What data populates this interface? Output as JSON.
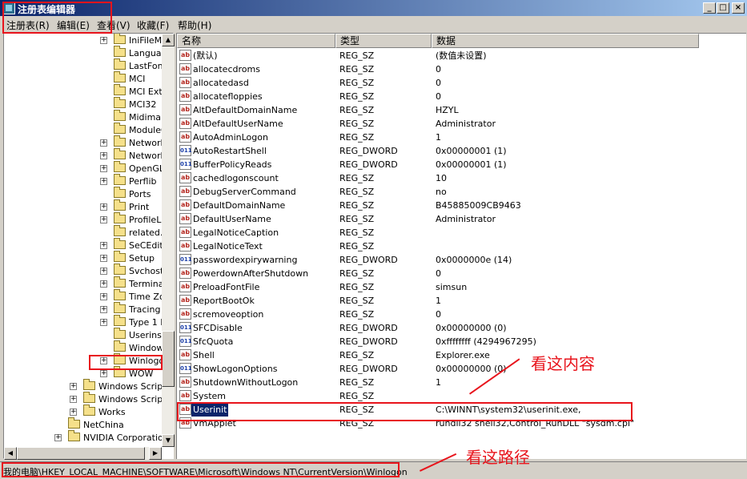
{
  "window": {
    "title": "注册表编辑器",
    "buttons": [
      "_",
      "□",
      "×"
    ]
  },
  "menu": [
    "注册表(R)",
    "编辑(E)",
    "查看(V)",
    "收藏(F)",
    "帮助(H)"
  ],
  "tree": {
    "items": [
      {
        "label": "IniFileMa",
        "expand": "+"
      },
      {
        "label": "Languag",
        "expand": ""
      },
      {
        "label": "LastFon",
        "expand": ""
      },
      {
        "label": "MCI",
        "expand": ""
      },
      {
        "label": "MCI Ext",
        "expand": ""
      },
      {
        "label": "MCI32",
        "expand": ""
      },
      {
        "label": "Midimap",
        "expand": ""
      },
      {
        "label": "ModuleC",
        "expand": ""
      },
      {
        "label": "Network",
        "expand": "+"
      },
      {
        "label": "Network",
        "expand": "+"
      },
      {
        "label": "OpenGL",
        "expand": "+"
      },
      {
        "label": "Perflib",
        "expand": "+"
      },
      {
        "label": "Ports",
        "expand": ""
      },
      {
        "label": "Print",
        "expand": "+"
      },
      {
        "label": "ProfileLi",
        "expand": "+"
      },
      {
        "label": "related.",
        "expand": ""
      },
      {
        "label": "SeCEdit",
        "expand": "+"
      },
      {
        "label": "Setup",
        "expand": "+"
      },
      {
        "label": "Svchost",
        "expand": "+"
      },
      {
        "label": "Termina",
        "expand": "+"
      },
      {
        "label": "Time Zo",
        "expand": "+"
      },
      {
        "label": "Tracing",
        "expand": "+"
      },
      {
        "label": "Type 1 I",
        "expand": "+"
      },
      {
        "label": "Userinst",
        "expand": ""
      },
      {
        "label": "Window",
        "expand": ""
      },
      {
        "label": "Winlogo",
        "expand": "+"
      },
      {
        "label": "WOW",
        "expand": "+"
      },
      {
        "label": "Windows Script",
        "expand": "+"
      },
      {
        "label": "Windows Scripti",
        "expand": "+"
      },
      {
        "label": "Works",
        "expand": "+"
      },
      {
        "label": "NetChina",
        "expand": ""
      },
      {
        "label": "NVIDIA Corporation",
        "expand": "+"
      }
    ]
  },
  "list": {
    "columns": [
      "名称",
      "类型",
      "数据"
    ],
    "rows": [
      {
        "name": "(默认)",
        "type": "REG_SZ",
        "data": "(数值未设置)",
        "icon": "ab"
      },
      {
        "name": "allocatecdroms",
        "type": "REG_SZ",
        "data": "0",
        "icon": "ab"
      },
      {
        "name": "allocatedasd",
        "type": "REG_SZ",
        "data": "0",
        "icon": "ab"
      },
      {
        "name": "allocatefloppies",
        "type": "REG_SZ",
        "data": "0",
        "icon": "ab"
      },
      {
        "name": "AltDefaultDomainName",
        "type": "REG_SZ",
        "data": "HZYL",
        "icon": "ab"
      },
      {
        "name": "AltDefaultUserName",
        "type": "REG_SZ",
        "data": "Administrator",
        "icon": "ab"
      },
      {
        "name": "AutoAdminLogon",
        "type": "REG_SZ",
        "data": "1",
        "icon": "ab"
      },
      {
        "name": "AutoRestartShell",
        "type": "REG_DWORD",
        "data": "0x00000001 (1)",
        "icon": "011"
      },
      {
        "name": "BufferPolicyReads",
        "type": "REG_DWORD",
        "data": "0x00000001 (1)",
        "icon": "011"
      },
      {
        "name": "cachedlogonscount",
        "type": "REG_SZ",
        "data": "10",
        "icon": "ab"
      },
      {
        "name": "DebugServerCommand",
        "type": "REG_SZ",
        "data": "no",
        "icon": "ab"
      },
      {
        "name": "DefaultDomainName",
        "type": "REG_SZ",
        "data": "B45885009CB9463",
        "icon": "ab"
      },
      {
        "name": "DefaultUserName",
        "type": "REG_SZ",
        "data": "Administrator",
        "icon": "ab"
      },
      {
        "name": "LegalNoticeCaption",
        "type": "REG_SZ",
        "data": "",
        "icon": "ab"
      },
      {
        "name": "LegalNoticeText",
        "type": "REG_SZ",
        "data": "",
        "icon": "ab"
      },
      {
        "name": "passwordexpirywarning",
        "type": "REG_DWORD",
        "data": "0x0000000e (14)",
        "icon": "011"
      },
      {
        "name": "PowerdownAfterShutdown",
        "type": "REG_SZ",
        "data": "0",
        "icon": "ab"
      },
      {
        "name": "PreloadFontFile",
        "type": "REG_SZ",
        "data": "simsun",
        "icon": "ab"
      },
      {
        "name": "ReportBootOk",
        "type": "REG_SZ",
        "data": "1",
        "icon": "ab"
      },
      {
        "name": "scremoveoption",
        "type": "REG_SZ",
        "data": "0",
        "icon": "ab"
      },
      {
        "name": "SFCDisable",
        "type": "REG_DWORD",
        "data": "0x00000000 (0)",
        "icon": "011"
      },
      {
        "name": "SfcQuota",
        "type": "REG_DWORD",
        "data": "0xffffffff (4294967295)",
        "icon": "011"
      },
      {
        "name": "Shell",
        "type": "REG_SZ",
        "data": "Explorer.exe",
        "icon": "ab"
      },
      {
        "name": "ShowLogonOptions",
        "type": "REG_DWORD",
        "data": "0x00000000 (0)",
        "icon": "011"
      },
      {
        "name": "ShutdownWithoutLogon",
        "type": "REG_SZ",
        "data": "1",
        "icon": "ab"
      },
      {
        "name": "System",
        "type": "REG_SZ",
        "data": "",
        "icon": "ab"
      },
      {
        "name": "Userinit",
        "type": "REG_SZ",
        "data": "C:\\WINNT\\system32\\userinit.exe,",
        "icon": "ab"
      },
      {
        "name": "VmApplet",
        "type": "REG_SZ",
        "data": "rundll32 shell32,Control_RunDLL \"sysdm.cpl\"",
        "icon": "ab"
      }
    ]
  },
  "status": {
    "path": "我的电脑\\HKEY_LOCAL_MACHINE\\SOFTWARE\\Microsoft\\Windows NT\\CurrentVersion\\Winlogon"
  },
  "annotations": {
    "content": "看这内容",
    "path": "看这路径"
  },
  "colors": {
    "annotation": "#e8141c",
    "selection": "#0a246a",
    "title_start": "#0a246a",
    "title_end": "#a6caf0"
  }
}
